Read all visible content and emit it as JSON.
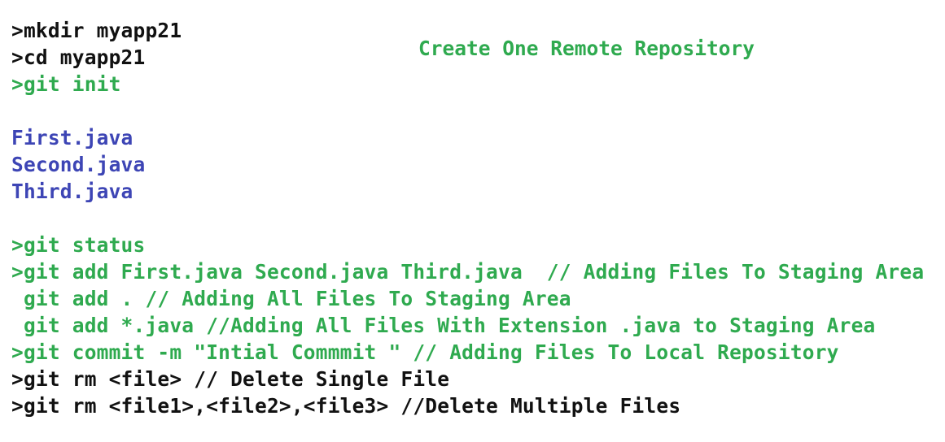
{
  "title": "Create One Remote Repository",
  "colors": {
    "command": "#111111",
    "git": "#2faa4f",
    "file": "#3d45b5"
  },
  "lines": {
    "mkdir": ">mkdir myapp21",
    "cd": ">cd myapp21",
    "git_init": ">git init",
    "file_first": "First.java",
    "file_second": "Second.java",
    "file_third": "Third.java",
    "git_status": ">git status",
    "git_add_files": ">git add First.java Second.java Third.java  // Adding Files To Staging Area",
    "git_add_all": " git add . // Adding All Files To Staging Area",
    "git_add_java": " git add *.java //Adding All Files With Extension .java to Staging Area",
    "git_commit": ">git commit -m \"Intial Commmit \" // Adding Files To Local Repository",
    "git_rm_single": ">git rm <file> // Delete Single File",
    "git_rm_multiple": ">git rm <file1>,<file2>,<file3> //Delete Multiple Files"
  }
}
